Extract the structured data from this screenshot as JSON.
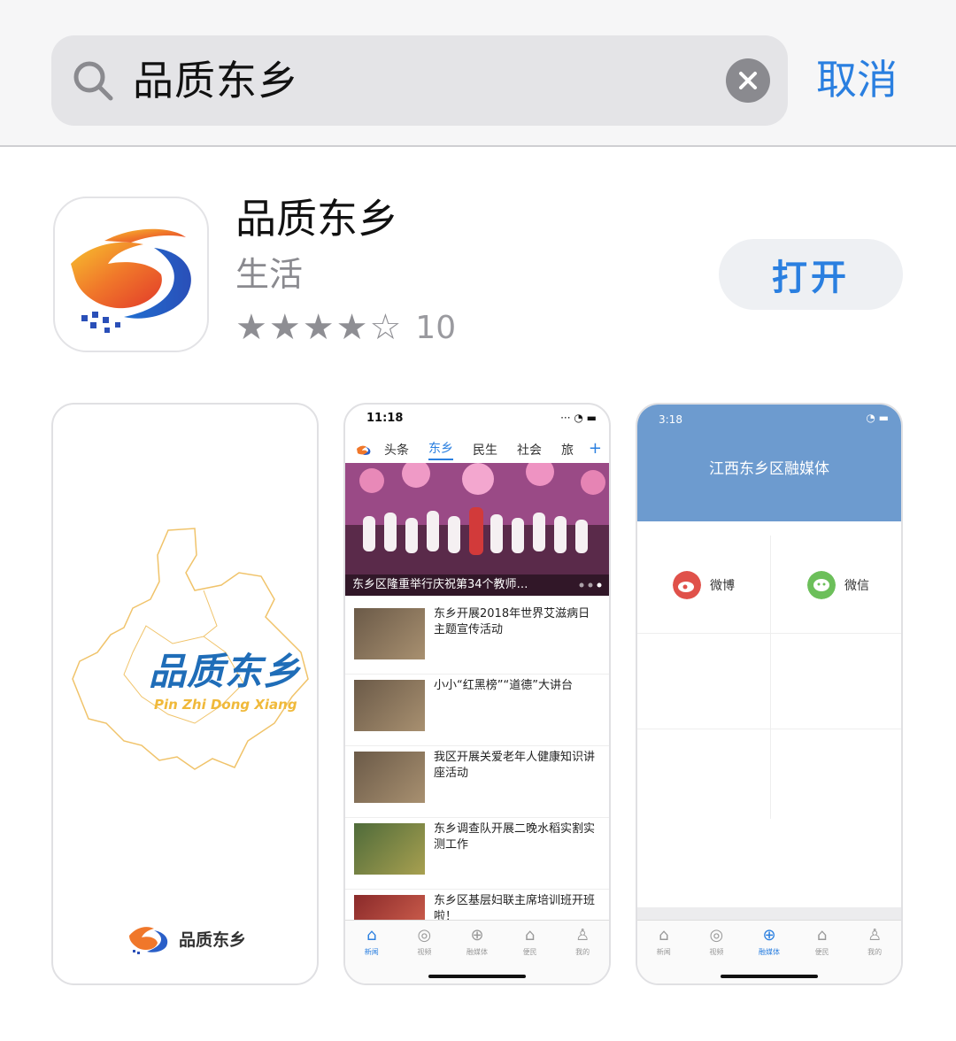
{
  "search": {
    "query": "品质东乡",
    "cancel_label": "取消"
  },
  "app": {
    "name": "品质东乡",
    "category": "生活",
    "rating_value": 4,
    "rating_max": 5,
    "rating_count": "10",
    "open_label": "打开"
  },
  "colors": {
    "accent": "#2a7fe0",
    "header_bg": "#f6f6f7",
    "search_bg": "#e4e4e7",
    "grey_text": "#8a8a8f",
    "blue_header": "#6d9bcf"
  },
  "icons": [
    "search-icon",
    "clear-icon",
    "star-icon",
    "home-icon",
    "camera-icon",
    "globe-icon",
    "house-icon",
    "person-icon",
    "weibo-icon",
    "wechat-icon",
    "wifi-icon",
    "battery-icon"
  ],
  "screenshots": {
    "splash": {
      "title": "品质东乡",
      "subtitle": "Pin Zhi Dong Xiang",
      "brand": "品质东乡"
    },
    "news": {
      "time": "11:18",
      "tabs": [
        "头条",
        "东乡",
        "民生",
        "社会",
        "旅"
      ],
      "active_tab": "东乡",
      "plus": "+",
      "hero_caption": "东乡区隆重举行庆祝第34个教师…",
      "items": [
        {
          "title": "东乡开展2018年世界艾滋病日主题宣传活动"
        },
        {
          "title": "小小“红黑榜”“道德”大讲台"
        },
        {
          "title": "我区开展关爱老年人健康知识讲座活动"
        },
        {
          "title": "东乡调查队开展二晚水稻实割实测工作"
        },
        {
          "title": "东乡区基层妇联主席培训班开班啦！"
        }
      ],
      "tabbar": [
        {
          "icon": "home-icon",
          "glyph": "⌂",
          "label": "新闻"
        },
        {
          "icon": "camera-icon",
          "glyph": "◎",
          "label": "视频"
        },
        {
          "icon": "globe-icon",
          "glyph": "⊕",
          "label": "融媒体"
        },
        {
          "icon": "house-icon",
          "glyph": "⌂",
          "label": "便民"
        },
        {
          "icon": "person-icon",
          "glyph": "♙",
          "label": "我的"
        }
      ],
      "active_tabbar": 0
    },
    "media": {
      "time": "3:18",
      "title": "江西东乡区融媒体",
      "weibo_label": "微博",
      "weixin_label": "微信",
      "tabbar": [
        {
          "icon": "home-icon",
          "glyph": "⌂",
          "label": "新闻"
        },
        {
          "icon": "camera-icon",
          "glyph": "◎",
          "label": "视频"
        },
        {
          "icon": "globe-icon",
          "glyph": "⊕",
          "label": "融媒体"
        },
        {
          "icon": "house-icon",
          "glyph": "⌂",
          "label": "便民"
        },
        {
          "icon": "person-icon",
          "glyph": "♙",
          "label": "我的"
        }
      ],
      "active_tabbar": 2
    }
  }
}
